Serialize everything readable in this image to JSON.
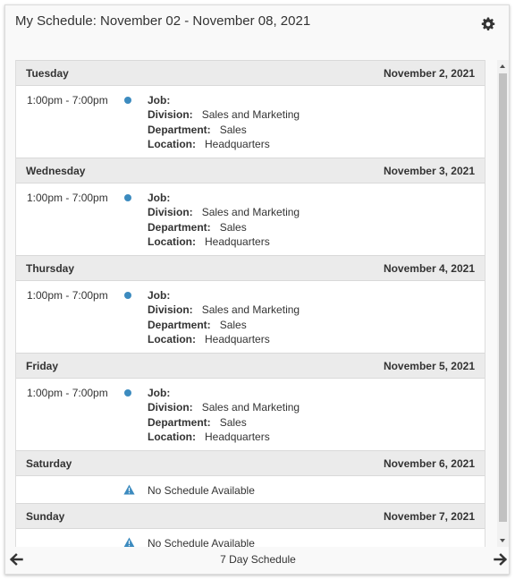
{
  "header": {
    "title": "My Schedule: November 02 - November 08, 2021"
  },
  "schedule": {
    "days": [
      {
        "day": "Tuesday",
        "date": "November 2, 2021",
        "time": "1:00pm - 7:00pm",
        "job_label": "Job:",
        "job_value": "",
        "division_label": "Division:",
        "division_value": "Sales and Marketing",
        "department_label": "Department:",
        "department_value": "Sales",
        "location_label": "Location:",
        "location_value": "Headquarters"
      },
      {
        "day": "Wednesday",
        "date": "November 3, 2021",
        "time": "1:00pm - 7:00pm",
        "job_label": "Job:",
        "job_value": "",
        "division_label": "Division:",
        "division_value": "Sales and Marketing",
        "department_label": "Department:",
        "department_value": "Sales",
        "location_label": "Location:",
        "location_value": "Headquarters"
      },
      {
        "day": "Thursday",
        "date": "November 4, 2021",
        "time": "1:00pm - 7:00pm",
        "job_label": "Job:",
        "job_value": "",
        "division_label": "Division:",
        "division_value": "Sales and Marketing",
        "department_label": "Department:",
        "department_value": "Sales",
        "location_label": "Location:",
        "location_value": "Headquarters"
      },
      {
        "day": "Friday",
        "date": "November 5, 2021",
        "time": "1:00pm - 7:00pm",
        "job_label": "Job:",
        "job_value": "",
        "division_label": "Division:",
        "division_value": "Sales and Marketing",
        "department_label": "Department:",
        "department_value": "Sales",
        "location_label": "Location:",
        "location_value": "Headquarters"
      },
      {
        "day": "Saturday",
        "date": "November 6, 2021",
        "empty_text": "No Schedule Available"
      },
      {
        "day": "Sunday",
        "date": "November 7, 2021",
        "empty_text": "No Schedule Available"
      }
    ]
  },
  "footer": {
    "label": "7 Day Schedule",
    "prev_icon": "arrow-left-icon",
    "next_icon": "arrow-right-icon"
  },
  "icons": {
    "settings": "gear-icon",
    "shift_marker": "dot-icon",
    "no_schedule": "warning-icon"
  },
  "colors": {
    "accent": "#3c8bbf",
    "header_bg": "#ebebeb",
    "text": "#333333"
  }
}
